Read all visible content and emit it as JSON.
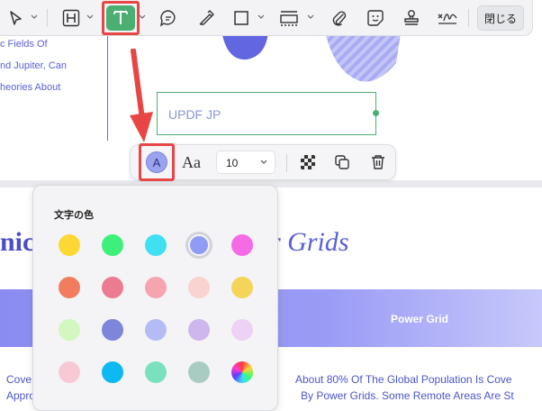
{
  "document": {
    "left_lines": [
      "c Fields Of",
      "nd Jupiter, Can",
      "heories About"
    ],
    "textbox_value": "UPDF JP",
    "heading_left": "nic",
    "heading_right": "r Grids",
    "band_label": "Power Grid",
    "body_left": [
      "Cove",
      "Appro"
    ],
    "body_right": [
      "About 80% Of The Global Population Is Cove",
      "By Power Grids. Some Remote Areas Are St"
    ]
  },
  "toolbar": {
    "close_label": "閉じる",
    "tools": [
      "select-tool",
      "highlight-tool",
      "text-tool",
      "comment-tool",
      "pencil-tool",
      "shape-tool",
      "textbox-tool",
      "attach-tool",
      "sticker-tool",
      "stamp-tool",
      "signature-tool"
    ]
  },
  "text_toolbar": {
    "color_glyph": "A",
    "font_glyph": "Aa",
    "font_size": "10"
  },
  "color_popup": {
    "title": "文字の色",
    "rows": [
      [
        "#fdd835",
        "#3ef07a",
        "#3ee0f2",
        "#8f9cf5",
        "#f56be6"
      ],
      [
        "#f47c5e",
        "#ec7a90",
        "#f6a4b0",
        "#f8d3cf",
        "#f5d45a"
      ],
      [
        "#d2f7bf",
        "#7e86d9",
        "#b4bcf5",
        "#cdb7ec",
        "#eed2f6"
      ],
      [
        "#f7c9d4",
        "#0db9f3",
        "#7be0bd",
        "#a9ccc2",
        "rainbow"
      ]
    ],
    "selected": [
      0,
      3
    ]
  },
  "colors": {
    "accent_green": "#4caf72",
    "highlight_red": "#e84545",
    "brand_blue": "#5b5fd6"
  }
}
